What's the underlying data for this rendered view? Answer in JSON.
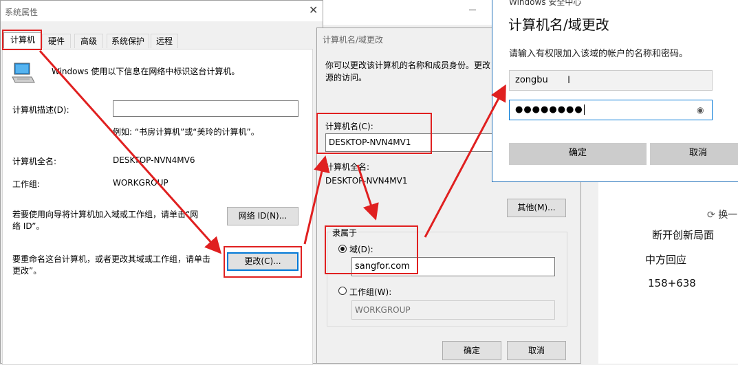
{
  "background_page": {
    "items": [
      "换一",
      "断开创新局面",
      "中方回应",
      "158+638"
    ]
  },
  "system_properties": {
    "title": "系统属性",
    "tabs": [
      "计算机名",
      "硬件",
      "高级",
      "系统保护",
      "远程"
    ],
    "intro": "Windows 使用以下信息在网络中标识这台计算机。",
    "description_label": "计算机描述(D):",
    "description_value": "",
    "description_example": "例如: “书房计算机”或“美玲的计算机”。",
    "full_name_label": "计算机全名:",
    "full_name_value": "DESKTOP-NVN4MV6",
    "workgroup_label": "工作组:",
    "workgroup_value": "WORKGROUP",
    "wizard_text_line1": "若要使用向导将计算机加入域或工作组，请单击“网",
    "wizard_text_line2": "络 ID”。",
    "network_id_button": "网络 ID(N)...",
    "rename_text_line1": "要重命名这台计算机，或者更改其域或工作组，请单击",
    "rename_text_line2": "更改”。",
    "change_button": "更改(C)..."
  },
  "name_change_dialog": {
    "title": "计算机名/域更改",
    "intro_line1": "你可以更改该计算机的名称和成员身份。更改",
    "intro_line2": "源的访问。",
    "computer_name_label": "计算机名(C):",
    "computer_name_value": "DESKTOP-NVN4MV1",
    "full_name_label": "计算机全名:",
    "full_name_value": "DESKTOP-NVN4MV1",
    "other_button": "其他(M)...",
    "member_of_label": "隶属于",
    "domain_label": "域(D):",
    "domain_value": "sangfor.com",
    "domain_selected": true,
    "workgroup_label": "工作组(W):",
    "workgroup_value": "WORKGROUP",
    "ok_button": "确定",
    "cancel_button": "取消"
  },
  "security_dialog": {
    "app_title": "Windows 安全中心",
    "heading": "计算机名/域更改",
    "prompt": "请输入有权限加入该域的帐户的名称和密码。",
    "username_value": "zongbu",
    "password_mask": "●●●●●●●●",
    "ok_button": "确定",
    "cancel_button": "取消"
  },
  "colors": {
    "highlight_red": "#e02020",
    "focus_blue": "#0078d7",
    "security_border": "#1e6fb8"
  }
}
